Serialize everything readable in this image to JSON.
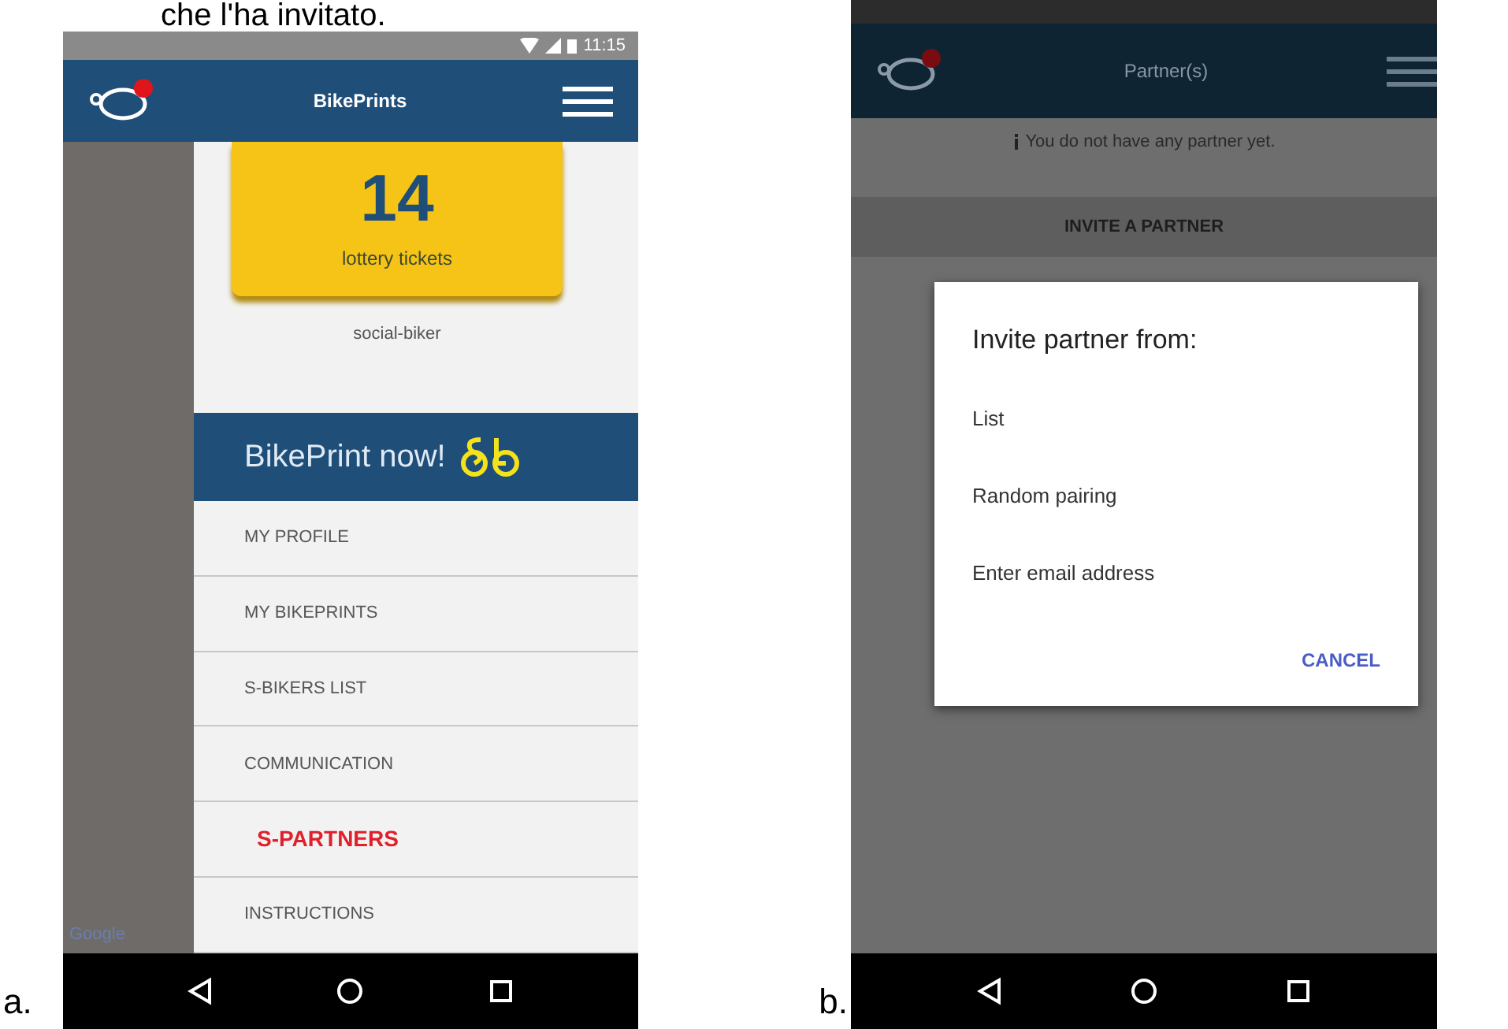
{
  "caption": "che l'ha invitato.",
  "panel_a": {
    "label": "a.",
    "status_bar": {
      "time": "11:15"
    },
    "app_bar": {
      "title": "BikePrints"
    },
    "map_attribution": "Google",
    "ticket": {
      "count": "14",
      "caption": "lottery tickets"
    },
    "username": "social-biker",
    "banner": "BikePrint now!",
    "menu": [
      {
        "label": "MY PROFILE",
        "selected": false
      },
      {
        "label": "MY BIKEPRINTS",
        "selected": false
      },
      {
        "label": "S-BIKERS LIST",
        "selected": false
      },
      {
        "label": "COMMUNICATION",
        "selected": false
      },
      {
        "label": "S-PARTNERS",
        "selected": true
      },
      {
        "label": "INSTRUCTIONS",
        "selected": false
      }
    ]
  },
  "panel_b": {
    "label": "b.",
    "app_bar": {
      "title": "Partner(s)"
    },
    "notice": "You do not have any partner yet.",
    "invite_button": "INVITE A PARTNER",
    "dialog": {
      "title": "Invite partner from:",
      "options": [
        "List",
        "Random pairing",
        "Enter email address"
      ],
      "cancel": "CANCEL"
    }
  }
}
